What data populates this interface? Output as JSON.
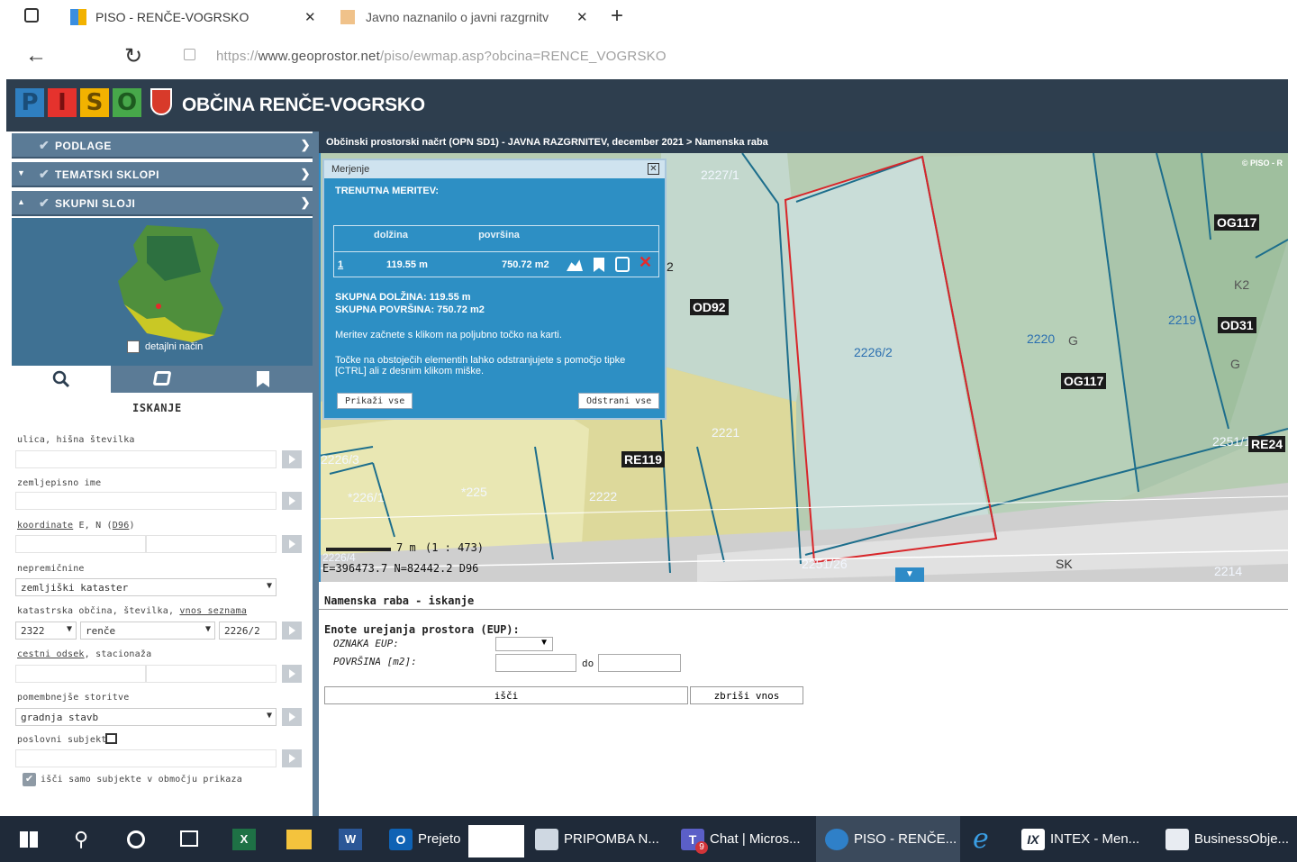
{
  "browser": {
    "tab1_title": "PISO - RENČE-VOGRSKO",
    "tab2_title": "Javno naznanilo o javni razgrnitv",
    "url_scheme": "https://",
    "url_host": "www.geoprostor.net",
    "url_path": "/piso/ewmap.asp?obcina=RENCE_VOGRSKO"
  },
  "header": {
    "logo_letters": [
      "P",
      "I",
      "S",
      "O"
    ],
    "municipality": "OBČINA RENČE-VOGRSKO"
  },
  "sidebar": {
    "menu": [
      {
        "label": "PODLAGE"
      },
      {
        "label": "TEMATSKI SKLOPI"
      },
      {
        "label": "SKUPNI SLOJI"
      }
    ],
    "detail_toggle": "detajlni način",
    "search_title": "ISKANJE",
    "fields": {
      "street_label": "ulica, hišna številka",
      "geo_label": "zemljepisno ime",
      "coord_label_link": "koordinate",
      "coord_label_mid": " E, N (",
      "coord_label_link2": "D96",
      "coord_label_end": ")",
      "property_label": "nepremičnine",
      "property_select": "zemljiški kataster",
      "cadastral_label": "katastrska občina, številka, ",
      "cadastral_link": "vnos seznama",
      "ko_code": "2322",
      "ko_name": "renče",
      "parcel_no": "2226/2",
      "road_label_link": "cestni odsek",
      "road_label_end": ", stacionaža",
      "services_label": "pomembnejše storitve",
      "services_select": "gradnja stavb",
      "business_label": "poslovni subjekt",
      "area_only_label": "išči samo subjekte v območju prikaza"
    }
  },
  "map": {
    "breadcrumb": "Občinski prostorski načrt (OPN SD1) - JAVNA RAZGRNITEV, december 2021 > Namenska raba",
    "copyright": "© PISO - R",
    "parcels": [
      "2227/1",
      "2226/2",
      "2220",
      "2219",
      "2221",
      "2222",
      "2226/3",
      "*226/1",
      "*225",
      "2226/4",
      "2251/26",
      "2251/1",
      "2214"
    ],
    "zone_labels": [
      "OD92",
      "OG117",
      "OG117",
      "OD31",
      "RE119",
      "RE24",
      "SK",
      "K2",
      "G",
      "G",
      "2"
    ],
    "scale": "7 m",
    "scale_ratio": "(1 : 473)",
    "coords": "E=396473.7   N=82442.2   D96"
  },
  "measure_dialog": {
    "title": "Merjenje",
    "current": "TRENUTNA MERITEV:",
    "col_length": "dolžina",
    "col_area": "površina",
    "row_index": "1",
    "length": "119.55 m",
    "area": "750.72 m2",
    "total_length": "SKUPNA DOLŽINA: 119.55 m",
    "total_area": "SKUPNA POVRŠINA: 750.72 m2",
    "hint1": "Meritev začnete s klikom na poljubno točko na karti.",
    "hint2": "Točke na obstoječih elementih lahko odstranjujete s pomočjo tipke [CTRL] ali z desnim klikom miške.",
    "show_all": "Prikaži vse",
    "remove_all": "Odstrani vse"
  },
  "namenska": {
    "title": "Namenska raba - iskanje",
    "section": "Enote urejanja prostora (EUP):",
    "eup_label": "OZNAKA EUP:",
    "area_label": "POVRŠINA [m2]:",
    "to_label": "do",
    "search_btn": "išči",
    "clear_btn": "zbriši vnos"
  },
  "taskbar": {
    "items": [
      "Prejeto",
      "PRIPOMBA N...",
      "Chat | Micros...",
      "PISO - RENČE...",
      "INTEX - Men...",
      "BusinessObje..."
    ],
    "teams_badge": "9"
  },
  "colors": {
    "header_bg": "#2e3e4e",
    "menu_bg": "#5b7b96",
    "dialog_bg": "#2d8fc4",
    "taskbar_bg": "#1f2a39"
  }
}
